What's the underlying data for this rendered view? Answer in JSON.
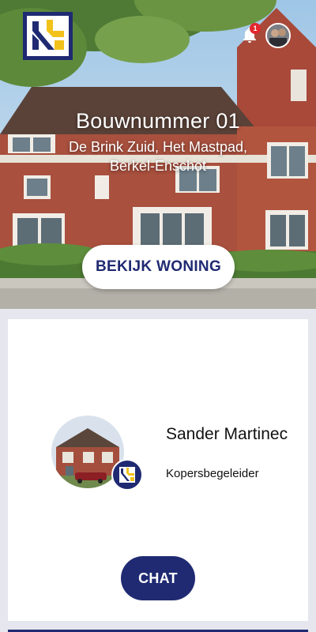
{
  "header": {
    "logo_icon": "brand-logo-icon",
    "notification_icon": "bell-icon",
    "notification_count": "1",
    "avatar_icon": "user-avatar"
  },
  "project": {
    "title": "Bouwnummer 01",
    "address": "De Brink Zuid, Het Mastpad, Berkel-Enschot",
    "view_button": "BEKIJK WONING"
  },
  "agent": {
    "name": "Sander Martinec",
    "role": "Kopersbegeleider",
    "chat_button": "CHAT"
  },
  "colors": {
    "brand_navy": "#1f2a72",
    "brand_yellow": "#f2c21b",
    "badge_red": "#e3262d"
  }
}
